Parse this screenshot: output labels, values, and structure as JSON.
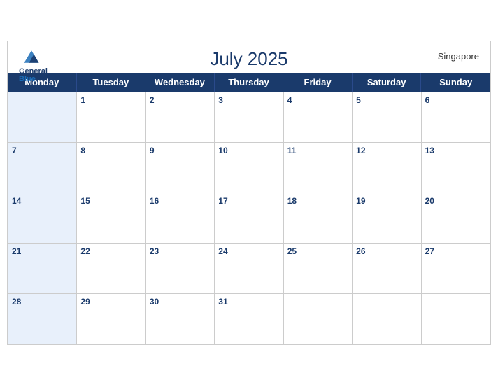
{
  "calendar": {
    "title": "July 2025",
    "country": "Singapore",
    "logo": {
      "line1": "General",
      "line2": "Blue"
    },
    "days_of_week": [
      "Monday",
      "Tuesday",
      "Wednesday",
      "Thursday",
      "Friday",
      "Saturday",
      "Sunday"
    ],
    "weeks": [
      [
        null,
        1,
        2,
        3,
        4,
        5,
        6
      ],
      [
        7,
        8,
        9,
        10,
        11,
        12,
        13
      ],
      [
        14,
        15,
        16,
        17,
        18,
        19,
        20
      ],
      [
        21,
        22,
        23,
        24,
        25,
        26,
        27
      ],
      [
        28,
        29,
        30,
        31,
        null,
        null,
        null
      ]
    ]
  }
}
